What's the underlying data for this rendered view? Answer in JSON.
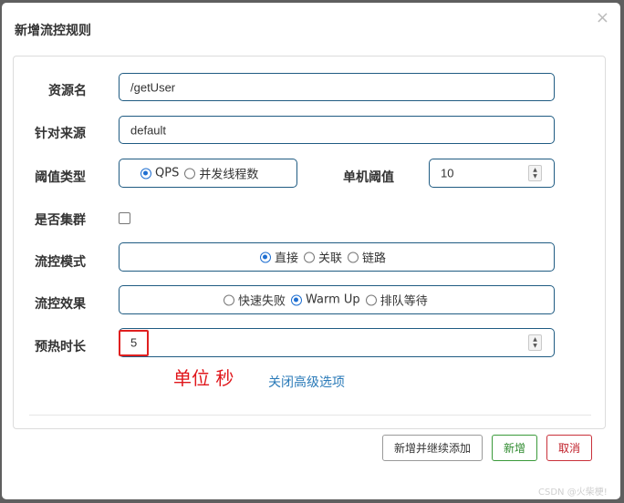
{
  "dialog": {
    "title": "新增流控规则",
    "close": "×"
  },
  "form": {
    "resource_label": "资源名",
    "resource_value": "/getUser",
    "source_label": "针对来源",
    "source_value": "default",
    "threshold_type_label": "阈值类型",
    "threshold_type_options": [
      "QPS",
      "并发线程数"
    ],
    "threshold_type_selected": "QPS",
    "single_threshold_label": "单机阈值",
    "single_threshold_value": "10",
    "cluster_label": "是否集群",
    "cluster_checked": false,
    "mode_label": "流控模式",
    "mode_options": [
      "直接",
      "关联",
      "链路"
    ],
    "mode_selected": "直接",
    "effect_label": "流控效果",
    "effect_options": [
      "快速失败",
      "Warm Up",
      "排队等待"
    ],
    "effect_selected": "Warm Up",
    "warmup_label": "预热时长",
    "warmup_value": "5",
    "annotation": "单位 秒",
    "advanced_link": "关闭高级选项"
  },
  "footer": {
    "add_continue_label": "新增并继续添加",
    "add_label": "新增",
    "cancel_label": "取消"
  },
  "watermark": "CSDN @火柴梗!",
  "colors": {
    "overlay": "#5f5f5f",
    "field_border": "#1f5b82",
    "radio_selected": "#1f6fd1",
    "annotation": "#e0161b",
    "link": "#2a7ab8",
    "add_button": "#2e8a2e",
    "cancel_button": "#c0202a"
  }
}
